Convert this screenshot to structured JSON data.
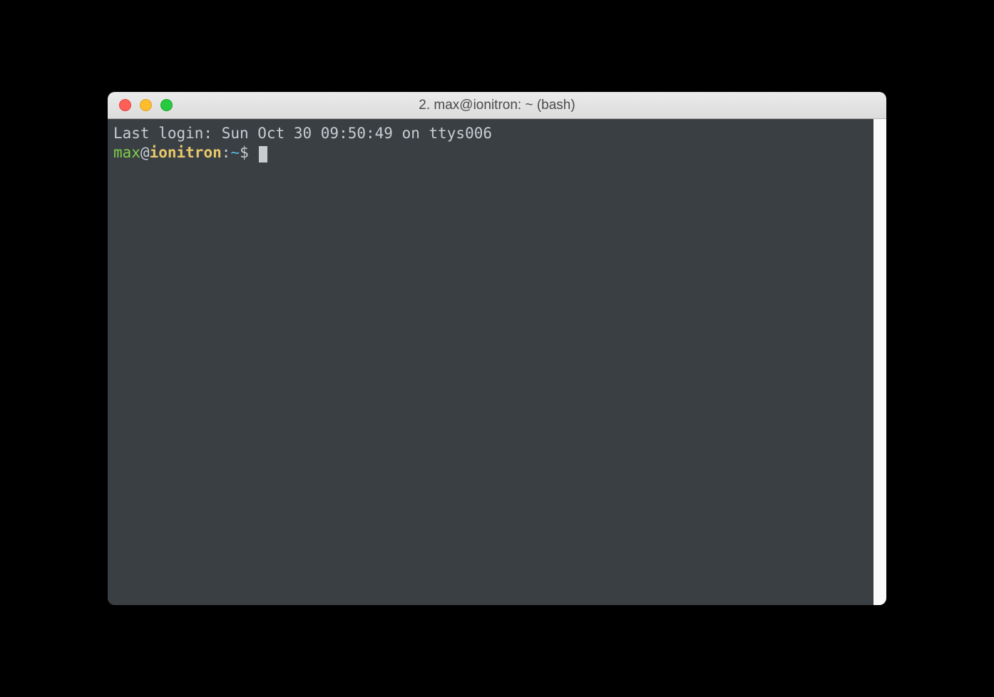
{
  "window": {
    "title": "2. max@ionitron: ~ (bash)"
  },
  "terminal": {
    "last_login": "Last login: Sun Oct 30 09:50:49 on ttys006",
    "prompt": {
      "user": "max",
      "at": "@",
      "host": "ionitron",
      "colon": ":",
      "path": "~",
      "dollar": "$ "
    }
  },
  "colors": {
    "background": "#3a3f44",
    "foreground": "#c8cdd2",
    "user": "#7fcf4a",
    "host": "#e8c86a",
    "path": "#57b6e0",
    "traffic_red": "#ff5f56",
    "traffic_yellow": "#ffbd2e",
    "traffic_green": "#27c93f"
  }
}
